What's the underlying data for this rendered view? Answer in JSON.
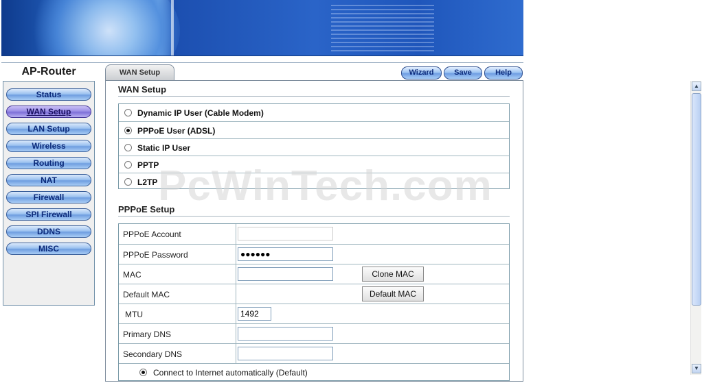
{
  "brand": "AP-Router",
  "sidebar": {
    "items": [
      {
        "label": "Status",
        "active": false
      },
      {
        "label": "WAN Setup",
        "active": true
      },
      {
        "label": "LAN Setup",
        "active": false
      },
      {
        "label": "Wireless",
        "active": false
      },
      {
        "label": "Routing",
        "active": false
      },
      {
        "label": "NAT",
        "active": false
      },
      {
        "label": "Firewall",
        "active": false
      },
      {
        "label": "SPI Firewall",
        "active": false
      },
      {
        "label": "DDNS",
        "active": false
      },
      {
        "label": "MISC",
        "active": false
      }
    ]
  },
  "tab": {
    "label": "WAN Setup"
  },
  "toolbar": {
    "wizard": "Wizard",
    "save": "Save",
    "help": "Help"
  },
  "wan": {
    "title": "WAN Setup",
    "options": [
      {
        "label": "Dynamic IP User (Cable Modem)",
        "selected": false
      },
      {
        "label": "PPPoE User (ADSL)",
        "selected": true
      },
      {
        "label": "Static IP User",
        "selected": false
      },
      {
        "label": "PPTP",
        "selected": false
      },
      {
        "label": "L2TP",
        "selected": false
      }
    ]
  },
  "pppoe": {
    "title": "PPPoE Setup",
    "account_label": "PPPoE Account",
    "account_value": "",
    "password_label": "PPPoE Password",
    "password_value": "●●●●●●",
    "mac_label": "MAC",
    "mac_value": "",
    "clone_mac": "Clone   MAC",
    "default_mac_label": "Default MAC",
    "default_mac_button": "Default MAC",
    "mtu_label": "MTU",
    "mtu_value": "1492",
    "primary_dns_label": "Primary DNS",
    "primary_dns_value": "",
    "secondary_dns_label": "Secondary DNS",
    "secondary_dns_value": "",
    "connect_auto": "Connect to Internet automatically (Default)"
  },
  "watermark": "PcWinTech.com"
}
